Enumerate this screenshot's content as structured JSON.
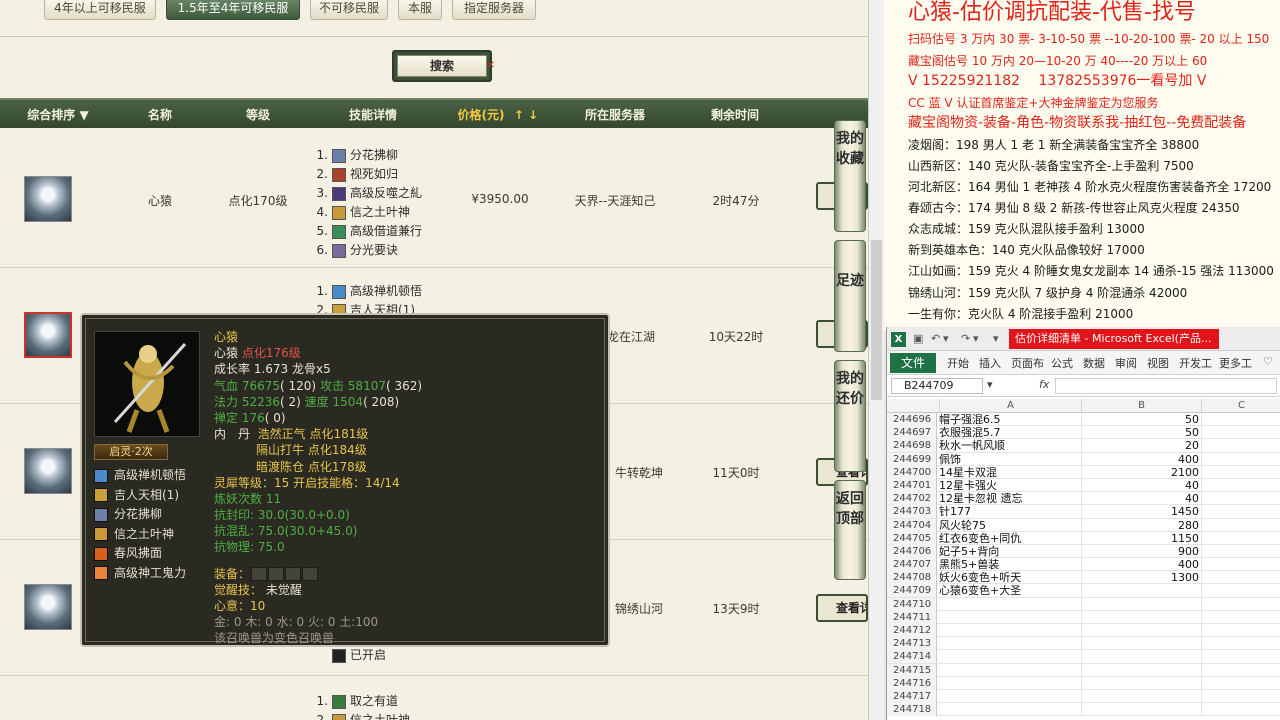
{
  "filters": {
    "f1": "4年以上可移民服",
    "f2": "1.5年至4年可移民服",
    "f3": "不可移民服",
    "f4": "本服",
    "f5": "指定服务器"
  },
  "search_label": "搜索",
  "columns": {
    "sort": "综合排序 ▼",
    "name": "名称",
    "level": "等级",
    "skills": "技能详情",
    "price": "价格(元)",
    "price_arrow": "↑ ↓",
    "server": "所在服务器",
    "time_left": "剩余时间"
  },
  "rows": [
    {
      "name": "心猿",
      "level": "点化170级",
      "skills": [
        "分花拂柳",
        "视死如归",
        "高级反噬之糺",
        "信之土叶神",
        "高级借道兼行",
        "分光要诀"
      ],
      "price": "¥3950.00",
      "server": "天界--天涯知己",
      "time_left": "2时47分"
    },
    {
      "skills": [
        "高级禅机顿悟",
        "吉人天相(1)"
      ],
      "server": "龙在江湖",
      "time_left": "10天22时"
    },
    {
      "server": "牛转乾坤",
      "time_left": "11天0时",
      "view_label": "查看详"
    },
    {
      "server": "锦绣山河",
      "time_left": "13天9时",
      "view_label": "查看详",
      "last_skill": "已开启"
    },
    {
      "skills": [
        "取之有道",
        "信之土叶神"
      ]
    }
  ],
  "side_buttons": {
    "fav": "我的收藏",
    "trace": "足迹",
    "bargain": "我的还价",
    "top": "返回顶部"
  },
  "tooltip": {
    "badge": "启灵·2次",
    "skills": [
      "高级禅机顿悟",
      "吉人天相(1)",
      "分花拂柳",
      "信之土叶神",
      "春风拂面",
      "高级神工鬼力"
    ],
    "name": "心猿",
    "name2": "心猿",
    "name2_level": "点化176级",
    "growth": "成长率 1.673 龙骨x5",
    "hp_label": "气血",
    "hp": "76675",
    "hp_extra": "( 120)",
    "atk_label": "攻击",
    "atk": "58107",
    "atk_extra": "( 362)",
    "mp_label": "法力",
    "mp": "52236",
    "mp_extra": "( 2)",
    "spd_label": "速度",
    "spd": "1504",
    "spd_extra": "( 208)",
    "zen_label": "禅定",
    "zen": "176",
    "zen_extra": "( 0)",
    "neidan_label": "内　丹",
    "neidan1": "浩然正气 点化181级",
    "neidan2": "隔山打牛 点化184级",
    "neidan3": "暗渡陈仓 点化178级",
    "spirit_label": "灵犀等级：",
    "spirit_text": "15 开启技能格：14/14",
    "lianyao_label": "炼妖次数",
    "lianyao": "11",
    "res1_label": "抗封印:",
    "res1": "30.0(30.0+0.0)",
    "res2_label": "抗混乱:",
    "res2": "75.0(30.0+45.0)",
    "res3_label": "抗物理:",
    "res3": "75.0",
    "equip_label": "装备：",
    "awake_label": "觉醒技：",
    "awake_value": "未觉醒",
    "spirit_val_label": "心意：",
    "spirit_val": "10",
    "elements": "金: 0 木: 0 水: 0 火: 0 土:100",
    "note": "该召唤兽为变色召唤兽"
  },
  "notes": {
    "title": "心猿-估价调抗配装-代售-找号",
    "l1": "扫码估号 3 万内 30 票- 3-10-50 票 --10-20-100 票- 20 以上 150",
    "l2": "藏宝阁估号 10 万内 20—10-20 万 40----20 万以上 60",
    "l3": "V 15225921182　 13782553976一看号加 V",
    "l4": "CC 蓝 V 认证首席鉴定+大神金牌鉴定为您服务",
    "l5": "藏宝阁物资-装备-角色-物资联系我-抽红包--免费配装备",
    "l6": "凌烟阁：198 男人 1 老 1 新全满装备宝宝齐全 38800",
    "l7": "山西新区：140 克火队-装备宝宝齐全-上手盈利 7500",
    "l8": "河北新区：164 男仙 1 老神孩 4 阶水克火程度伤害装备齐全 17200",
    "l9": "春颂古今：174 男仙 8 级 2 新孩-传世容止风克火程度 24350",
    "l10": "众志成城：159 克火队混队接手盈利 13000",
    "l11": "新到英雄本色：140 克火队品像较好 17000",
    "l12": "江山如画：159 克火 4 阶睡女鬼女龙副本 14 通杀-15 强法 113000",
    "l13": "锦绣山河：159 克火队 7 级护身 4 阶混通杀 42000",
    "l14": "一生有你：克火队 4 阶混接手盈利 21000"
  },
  "excel": {
    "logo": "X",
    "doc_title": "估价详细清单 - Microsoft Excel(产品...",
    "tabs": [
      "开始",
      "插入",
      "页面布",
      "公式",
      "数据",
      "审阅",
      "视图",
      "开发工",
      "更多工"
    ],
    "file_tab": "文件",
    "namebox": "B244709",
    "fx": "fx",
    "col_a": "A",
    "col_b": "B",
    "col_c": "C",
    "rows": [
      {
        "r": "244696",
        "a": "帽子强混6.5",
        "b": "50"
      },
      {
        "r": "244697",
        "a": "衣服强混5.7",
        "b": "50"
      },
      {
        "r": "244698",
        "a": "秋水一帆风顺",
        "b": "20"
      },
      {
        "r": "244699",
        "a": "佩饰",
        "b": "400"
      },
      {
        "r": "244700",
        "a": "14星卡双混",
        "b": "2100"
      },
      {
        "r": "244701",
        "a": "12星卡强火",
        "b": "40"
      },
      {
        "r": "244702",
        "a": "12星卡忽视 遗忘",
        "b": "40"
      },
      {
        "r": "244703",
        "a": "针177",
        "b": "1450"
      },
      {
        "r": "244704",
        "a": "风火轮75",
        "b": "280"
      },
      {
        "r": "244705",
        "a": "红衣6变色+同仇",
        "b": "1150"
      },
      {
        "r": "244706",
        "a": "妃子5+背向",
        "b": "900"
      },
      {
        "r": "244707",
        "a": "黑熊5+兽装",
        "b": "400"
      },
      {
        "r": "244708",
        "a": "妖火6变色+听天",
        "b": "1300"
      },
      {
        "r": "244709",
        "a": "心猿6变色+大圣",
        "b": ""
      },
      {
        "r": "244710",
        "a": "",
        "b": ""
      },
      {
        "r": "244711",
        "a": "",
        "b": ""
      },
      {
        "r": "244712",
        "a": "",
        "b": ""
      },
      {
        "r": "244713",
        "a": "",
        "b": ""
      },
      {
        "r": "244714",
        "a": "",
        "b": ""
      },
      {
        "r": "244715",
        "a": "",
        "b": ""
      },
      {
        "r": "244716",
        "a": "",
        "b": ""
      },
      {
        "r": "244717",
        "a": "",
        "b": ""
      },
      {
        "r": "244718",
        "a": "",
        "b": ""
      }
    ]
  },
  "colors": {
    "header_green": "#3f5639",
    "accent_red": "#e0231a",
    "excel_green": "#1f7246",
    "tooltip_bg": "#2b2a22",
    "gold_text": "#e7c44a"
  }
}
